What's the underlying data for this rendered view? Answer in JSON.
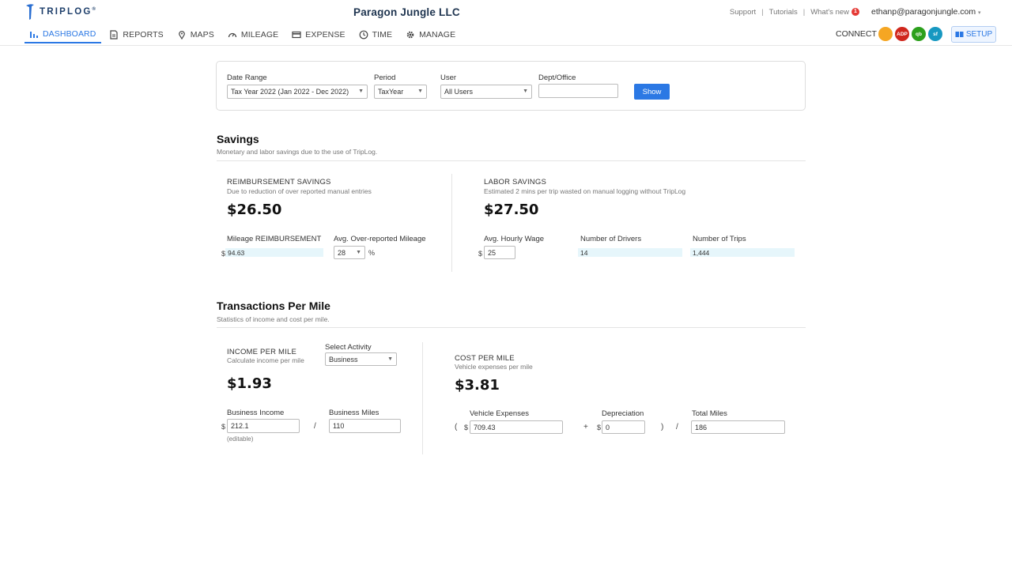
{
  "header": {
    "logo": "TRIPLOG",
    "logo_mark": "®",
    "company": "Paragon Jungle LLC",
    "links": [
      "Support",
      "Tutorials",
      "What's new"
    ],
    "separator": "|",
    "new_badge": "1",
    "user_email": "ethanp@paragonjungle.com",
    "user_caret": "▾"
  },
  "nav": {
    "items": [
      {
        "label": "DASHBOARD",
        "icon": "bar-chart-icon"
      },
      {
        "label": "REPORTS",
        "icon": "document-icon"
      },
      {
        "label": "MAPS",
        "icon": "map-pin-icon"
      },
      {
        "label": "MILEAGE",
        "icon": "speedometer-icon"
      },
      {
        "label": "EXPENSE",
        "icon": "card-icon"
      },
      {
        "label": "TIME",
        "icon": "clock-icon"
      },
      {
        "label": "MANAGE",
        "icon": "gear-icon"
      }
    ],
    "connect_label": "CONNECT",
    "connect_icons": [
      {
        "name": "gusto-icon",
        "text": "",
        "color": "#f5a623"
      },
      {
        "name": "adp-icon",
        "text": "ADP",
        "color": "#d0271d"
      },
      {
        "name": "quickbooks-icon",
        "text": "qb",
        "color": "#2ca01c"
      },
      {
        "name": "salesforce-icon",
        "text": "sf",
        "color": "#1798c1"
      }
    ],
    "setup_label": "SETUP"
  },
  "filter": {
    "date_range_label": "Date Range",
    "date_range_value": "Tax Year 2022 (Jan 2022 - Dec 2022)",
    "period_label": "Period",
    "period_value": "TaxYear",
    "user_label": "User",
    "user_value": "All Users",
    "dept_label": "Dept/Office",
    "dept_value": "",
    "show_label": "Show",
    "caret": "▼"
  },
  "savings": {
    "title": "Savings",
    "subtitle": "Monetary and labor savings due to the use of TripLog.",
    "reimbursement": {
      "caption": "REIMBURSEMENT SAVINGS",
      "desc": "Due to reduction of over reported manual entries",
      "amount": "$26.50",
      "mileage_label": "Mileage REIMBURSEMENT",
      "mileage_value": "94.63",
      "overreported_label": "Avg. Over-reported Mileage",
      "overreported_value": "28",
      "percent": "%"
    },
    "labor": {
      "caption": "LABOR SAVINGS",
      "desc": "Estimated 2 mins per trip wasted on manual logging without TripLog",
      "amount": "$27.50",
      "wage_label": "Avg. Hourly Wage",
      "wage_value": "25",
      "drivers_label": "Number of Drivers",
      "drivers_value": "14",
      "trips_label": "Number of Trips",
      "trips_value": "1,444"
    },
    "currency": "$"
  },
  "transactions": {
    "title": "Transactions Per Mile",
    "subtitle": "Statistics of income and cost per mile.",
    "income": {
      "caption": "INCOME PER MILE",
      "desc": "Calculate income per mile",
      "activity_label": "Select Activity",
      "activity_value": "Business",
      "amount": "$1.93",
      "business_income_label": "Business Income",
      "business_income_value": "212.1",
      "business_miles_label": "Business Miles",
      "business_miles_value": "110",
      "editable_note": "(editable)",
      "divide": "/"
    },
    "cost": {
      "caption": "COST PER MILE",
      "desc": "Vehicle expenses per mile",
      "amount": "$3.81",
      "vehicle_expenses_label": "Vehicle Expenses",
      "vehicle_expenses_value": "709.43",
      "depreciation_label": "Depreciation",
      "depreciation_value": "0",
      "total_miles_label": "Total Miles",
      "total_miles_value": "186",
      "open_paren": "(",
      "plus": "+",
      "close_paren": ")",
      "divide": "/"
    }
  }
}
